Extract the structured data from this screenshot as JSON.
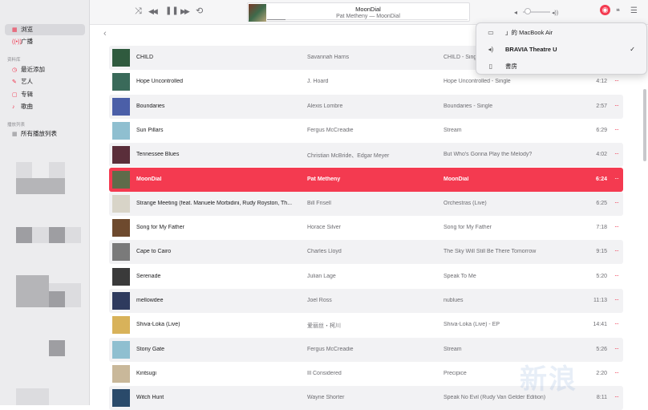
{
  "sidebar": {
    "items": [
      {
        "label": "浏览",
        "icon": "grid-icon"
      },
      {
        "label": "广播",
        "icon": "radio-icon"
      }
    ],
    "library_header": "资料库",
    "library": [
      {
        "label": "最近添加",
        "icon": "clock-icon"
      },
      {
        "label": "艺人",
        "icon": "microphone-icon"
      },
      {
        "label": "专辑",
        "icon": "album-icon"
      },
      {
        "label": "歌曲",
        "icon": "note-icon"
      }
    ],
    "playlists_header": "播放列表",
    "playlists": [
      {
        "label": "所有播放列表",
        "icon": "grid-icon"
      }
    ]
  },
  "player": {
    "icons": {
      "shuffle": "⤨",
      "prev": "◀◀",
      "play_pause": "❚❚",
      "next": "▶▶",
      "repeat": "⟲",
      "volume_low": "◂",
      "volume_high": "◂))",
      "airplay": "◉",
      "lyrics": "❝",
      "queue": "☰"
    },
    "now_playing_title": "MoonDial",
    "now_playing_subtitle": "Pat Metheny — MoonDial",
    "progress": 0.09,
    "volume": 0.1
  },
  "airplay": {
    "devices": [
      {
        "name": "  」的 MacBook Air",
        "icon": "laptop-icon",
        "glyph": "▭",
        "selected": false
      },
      {
        "name": "BRAVIA Theatre U",
        "icon": "speaker-icon",
        "glyph": "◂)",
        "selected": true
      },
      {
        "name": "書房",
        "icon": "homepod-icon",
        "glyph": "▯",
        "selected": false
      }
    ],
    "check": "✓"
  },
  "navigation": {
    "back": "‹"
  },
  "colors": {
    "accent": "#f43a50",
    "selected_row": "#f43a50"
  },
  "songs": [
    {
      "title": "CHILD",
      "artist": "Savannah Harris",
      "album": "CHILD - Single",
      "time": "",
      "art": "#2f5a3e"
    },
    {
      "title": "Hope Uncontrolled",
      "artist": "J. Hoard",
      "album": "Hope Uncontrolled - Single",
      "time": "4:12",
      "art": "#3a6a5a"
    },
    {
      "title": "Boundaries",
      "artist": "Alexis Lombre",
      "album": "Boundaries - Single",
      "time": "2:57",
      "art": "#4b5fa8"
    },
    {
      "title": "Sun Pillars",
      "artist": "Fergus McCreadie",
      "album": "Stream",
      "time": "6:29",
      "art": "#8fbfd0"
    },
    {
      "title": "Tennessee Blues",
      "artist": "Christian McBride、Edgar Meyer",
      "album": "But Who's Gonna Play the Melody?",
      "time": "4:02",
      "art": "#5a2e3a"
    },
    {
      "title": "MoonDial",
      "artist": "Pat Metheny",
      "album": "MoonDial",
      "time": "6:24",
      "art": "#5e6b4a"
    },
    {
      "title": "Strange Meeting (feat. Manuele Morbidini, Rudy Royston, Th...",
      "artist": "Bill Frisell",
      "album": "Orchestras (Live)",
      "time": "6:25",
      "art": "#d8d4c8"
    },
    {
      "title": "Song for My Father",
      "artist": "Horace Silver",
      "album": "Song for My Father",
      "time": "7:18",
      "art": "#6e4a2e"
    },
    {
      "title": "Cape to Cairo",
      "artist": "Charles Lloyd",
      "album": "The Sky Will Still Be There Tomorrow",
      "time": "9:15",
      "art": "#7a7a7a"
    },
    {
      "title": "Serenade",
      "artist": "Julian Lage",
      "album": "Speak To Me",
      "time": "5:20",
      "art": "#3a3a3a"
    },
    {
      "title": "mellowdee",
      "artist": "Joel Ross",
      "album": "nublues",
      "time": "11:13",
      "art": "#2e3a5e"
    },
    {
      "title": "Shiva-Loka (Live)",
      "artist": "爱丽丝・柯川",
      "album": "Shiva-Loka (Live) - EP",
      "time": "14:41",
      "art": "#d8b25a"
    },
    {
      "title": "Stony Gate",
      "artist": "Fergus McCreadie",
      "album": "Stream",
      "time": "5:26",
      "art": "#8fbfd0"
    },
    {
      "title": "Kintsugi",
      "artist": "Ill Considered",
      "album": "Precipice",
      "time": "2:20",
      "art": "#c9b89a"
    },
    {
      "title": "Witch Hunt",
      "artist": "Wayne Shorter",
      "album": "Speak No Evil (Rudy Van Gelder Edition)",
      "time": "8:11",
      "art": "#2a4a6a"
    }
  ],
  "more_label": "···",
  "watermark": "新浪"
}
